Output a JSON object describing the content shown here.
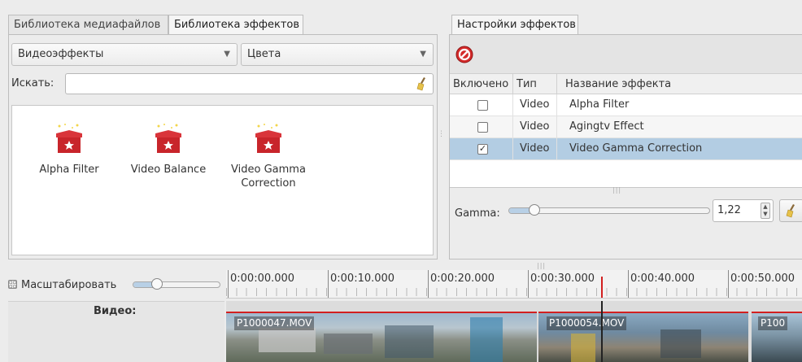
{
  "left_tabs": [
    {
      "label": "Библиотека медиафайлов",
      "active": false
    },
    {
      "label": "Библиотека эффектов",
      "active": true
    }
  ],
  "category_combo": {
    "value": "Видеоэффекты"
  },
  "subcategory_combo": {
    "value": "Цвета"
  },
  "search": {
    "label": "Искать:",
    "value": ""
  },
  "effects": [
    {
      "label": "Alpha Filter"
    },
    {
      "label": "Video Balance"
    },
    {
      "label": "Video Gamma Correction"
    }
  ],
  "right_tab": {
    "label": "Настройки эффектов"
  },
  "effect_table": {
    "headers": {
      "enabled": "Включено",
      "type": "Тип",
      "name": "Название эффекта"
    },
    "rows": [
      {
        "enabled": false,
        "type": "Video",
        "name": "Alpha Filter",
        "selected": false
      },
      {
        "enabled": false,
        "type": "Video",
        "name": "Agingtv Effect",
        "selected": false
      },
      {
        "enabled": true,
        "type": "Video",
        "name": "Video Gamma Correction",
        "selected": true
      }
    ]
  },
  "gamma": {
    "label": "Gamma:",
    "value": "1,22",
    "slider_fraction": 0.05
  },
  "zoom": {
    "label": "Масштабировать",
    "slider_fraction": 0.3
  },
  "ruler": {
    "ticks": [
      "0:00:00.000",
      "0:00:10.000",
      "0:00:20.000",
      "0:00:30.000",
      "0:00:40.000",
      "0:00:50.000"
    ]
  },
  "track": {
    "label": "Видео:"
  },
  "clips": [
    {
      "label": "P1000047.MOV"
    },
    {
      "label": "P1000054.MOV"
    },
    {
      "label": "P100"
    }
  ],
  "colors": {
    "selection": "#b3cde3",
    "playhead": "#d22020",
    "icon_red": "#c8252b"
  },
  "icons": {
    "remove": "no-entry-icon",
    "clear": "broom-icon",
    "effect": "gift-box-icon"
  }
}
